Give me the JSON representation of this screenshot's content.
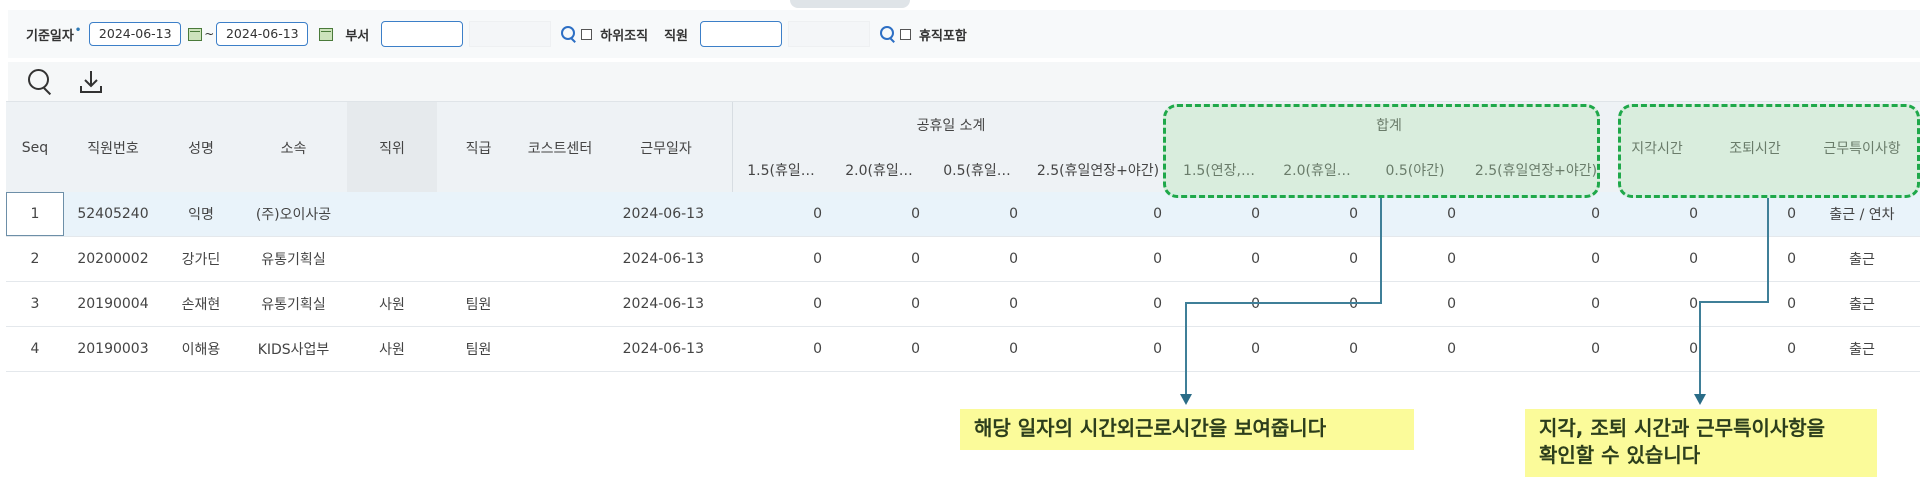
{
  "filter": {
    "base_date_label": "기준일자",
    "required_mark": "•",
    "date_from": "2024-06-13",
    "date_to": "2024-06-13",
    "range_sep": "~",
    "dept_label": "부서",
    "sub_org_label": "하위조직",
    "employee_label": "직원",
    "include_leave_label": "휴직포함"
  },
  "grid": {
    "headers": {
      "seq": "Seq",
      "emp_no": "직원번호",
      "name": "성명",
      "dept": "소속",
      "position": "직위",
      "grade": "직급",
      "cost_center": "코스트센터",
      "work_date": "근무일자",
      "holiday_group": "공휴일 소계",
      "holiday_cols": [
        "1.5(휴일…",
        "2.0(휴일…",
        "0.5(휴일…",
        "2.5(휴일연장+야간)"
      ],
      "total_group": "합계",
      "total_cols": [
        "1.5(연장,…",
        "2.0(휴일…",
        "0.5(야간)",
        "2.5(휴일연장+야간)"
      ],
      "late": "지각시간",
      "early": "조퇴시간",
      "note": "근무특이사항"
    },
    "rows": [
      {
        "seq": "1",
        "emp_no": "52405240",
        "name": "익명",
        "dept": "(주)오이사공",
        "position": "",
        "grade": "",
        "cost_center": "",
        "work_date": "2024-06-13",
        "h": [
          "0",
          "0",
          "0",
          "0"
        ],
        "t": [
          "0",
          "0",
          "0",
          "0"
        ],
        "late": "0",
        "early": "0",
        "note": "출근 / 연차"
      },
      {
        "seq": "2",
        "emp_no": "20200002",
        "name": "강가딘",
        "dept": "유통기획실",
        "position": "",
        "grade": "",
        "cost_center": "",
        "work_date": "2024-06-13",
        "h": [
          "0",
          "0",
          "0",
          "0"
        ],
        "t": [
          "0",
          "0",
          "0",
          "0"
        ],
        "late": "0",
        "early": "0",
        "note": "출근"
      },
      {
        "seq": "3",
        "emp_no": "20190004",
        "name": "손재현",
        "dept": "유통기획실",
        "position": "사원",
        "grade": "팀원",
        "cost_center": "",
        "work_date": "2024-06-13",
        "h": [
          "0",
          "0",
          "0",
          "0"
        ],
        "t": [
          "0",
          "0",
          "0",
          "0"
        ],
        "late": "0",
        "early": "0",
        "note": "출근"
      },
      {
        "seq": "4",
        "emp_no": "20190003",
        "name": "이해용",
        "dept": "KIDS사업부",
        "position": "사원",
        "grade": "팀원",
        "cost_center": "",
        "work_date": "2024-06-13",
        "h": [
          "0",
          "0",
          "0",
          "0"
        ],
        "t": [
          "0",
          "0",
          "0",
          "0"
        ],
        "late": "0",
        "early": "0",
        "note": "출근"
      }
    ]
  },
  "callouts": {
    "overtime": "해당 일자의 시간외근로시간을 보여줍니다",
    "late_early_line1": "지각, 조퇴 시간과 근무특이사항을",
    "late_early_line2": "확인할 수 있습니다"
  },
  "colors": {
    "highlight_border": "#1fa84a",
    "callout_bg": "#fbfb9a",
    "input_border": "#3c7fc8"
  }
}
